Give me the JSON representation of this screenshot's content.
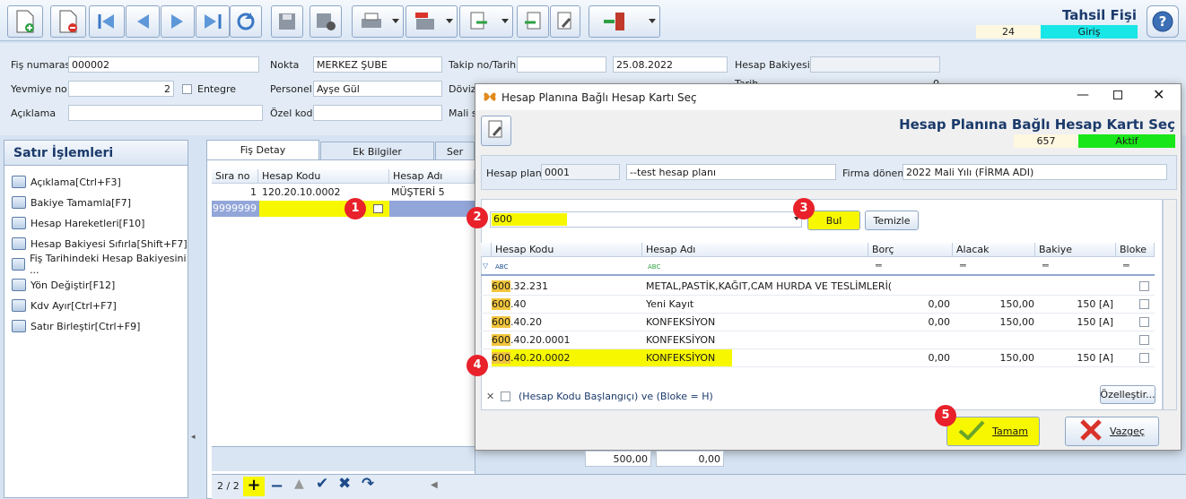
{
  "toolbar": {
    "title": "Tahsil Fişi",
    "record_no": "24",
    "mode": "Giriş"
  },
  "header": {
    "fis_no_label": "Fiş numarası",
    "fis_no": "000002",
    "yevmiye_label": "Yevmiye no",
    "yevmiye": "2",
    "entegre_label": "Entegre",
    "aciklama_label": "Açıklama",
    "nokta_label": "Nokta",
    "nokta": "MERKEZ ŞUBE",
    "personel_label": "Personel",
    "personel": "Ayşe Gül",
    "ozel_kod_label": "Özel kod",
    "takip_label": "Takip no/Tarih",
    "tarih": "25.08.2022",
    "doviz_label": "Döviz/",
    "mali_label": "Mali so",
    "bakiye_label": "Hesap Bakiyesi",
    "second_line_label": "Tarih Bakiye",
    "second_value": "0"
  },
  "left_panel": {
    "title": "Satır İşlemleri",
    "items": [
      "Açıklama[Ctrl+F3]",
      "Bakiye Tamamla[F7]",
      "Hesap Hareketleri[F10]",
      "Hesap Bakiyesi Sıfırla[Shift+F7]",
      "Fiş Tarihindeki Hesap Bakiyesini ...",
      "Yön Değiştir[F12]",
      "Kdv Ayır[Ctrl+F7]",
      "Satır Birleştir[Ctrl+F9]"
    ]
  },
  "tabs": [
    "Fiş Detay",
    "Ek Bilgiler",
    "Ser"
  ],
  "grid": {
    "columns": [
      "Sıra no",
      "Hesap Kodu",
      "Hesap Adı"
    ],
    "rows": [
      {
        "sira": "1",
        "kod": "120.20.10.0002",
        "ad": "MÜŞTERİ 5"
      },
      {
        "sira": "9999999",
        "kod": "",
        "ad": ""
      }
    ],
    "total1": "500,00",
    "total2": "0,00",
    "pager": "2 / 2"
  },
  "dialog": {
    "window_title": "Hesap Planına Bağlı Hesap Kartı Seç",
    "title": "Hesap Planına Bağlı Hesap Kartı Seç",
    "record_no": "657",
    "status": "Aktif",
    "plan_label": "Hesap planı",
    "plan_code": "0001",
    "plan_name": "--test hesap planı",
    "firma_label": "Firma dönemi",
    "firma": "2022 Mali Yılı (FİRMA ADI)",
    "search": "600",
    "find": "Bul",
    "clear": "Temizle",
    "columns": [
      "Hesap Kodu",
      "Hesap Adı",
      "Borç",
      "Alacak",
      "Bakiye",
      "Bloke"
    ],
    "rows": [
      {
        "kod_pre": "600",
        "kod_rest": ".32.231",
        "ad": "METAL,PASTİK,KAĞIT,CAM HURDA VE TESLİMLERİ(",
        "borc": "",
        "alacak": "",
        "bakiye": ""
      },
      {
        "kod_pre": "600",
        "kod_rest": ".40",
        "ad": "Yeni Kayıt",
        "borc": "0,00",
        "alacak": "150,00",
        "bakiye": "150 [A]"
      },
      {
        "kod_pre": "600",
        "kod_rest": ".40.20",
        "ad": "KONFEKSİYON",
        "borc": "0,00",
        "alacak": "150,00",
        "bakiye": "150 [A]"
      },
      {
        "kod_pre": "600",
        "kod_rest": ".40.20.0001",
        "ad": "KONFEKSİYON",
        "borc": "",
        "alacak": "",
        "bakiye": ""
      },
      {
        "kod_pre": "600",
        "kod_rest": ".40.20.0002",
        "ad": "KONFEKSİYON",
        "borc": "0,00",
        "alacak": "150,00",
        "bakiye": "150 [A]"
      }
    ],
    "filter": "(Hesap Kodu Başlangıçı) ve (Bloke = H)",
    "customize": "Özelleştir...",
    "ok": "Tamam",
    "cancel": "Vazgeç"
  },
  "badges": [
    "1",
    "2",
    "3",
    "4",
    "5"
  ],
  "colors": {
    "accent": "#1b3a6b",
    "active": "#19e619",
    "mode": "#19e6e6",
    "highlight": "#f7f700",
    "badge": "#e8212a"
  }
}
